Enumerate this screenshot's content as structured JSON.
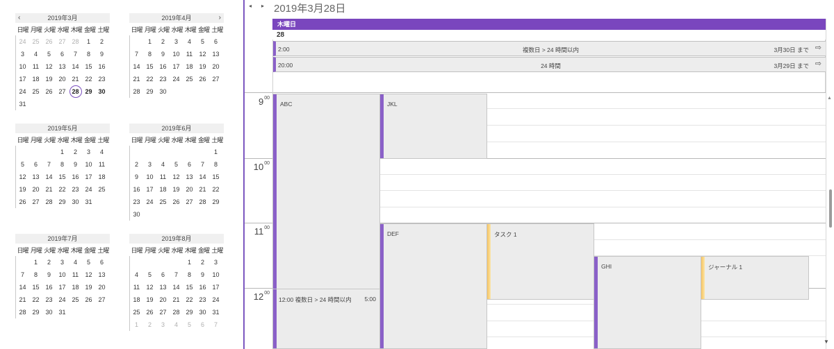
{
  "mini_calendars": {
    "weekdays": [
      "日曜",
      "月曜",
      "火曜",
      "水曜",
      "木曜",
      "金曜",
      "土曜"
    ],
    "nav": {
      "prev": "‹",
      "next": "›"
    },
    "months": [
      {
        "title": "2019年3月",
        "days": [
          {
            "d": "24",
            "o": true
          },
          {
            "d": "25",
            "o": true
          },
          {
            "d": "26",
            "o": true
          },
          {
            "d": "27",
            "o": true
          },
          {
            "d": "28",
            "o": true
          },
          {
            "d": "1"
          },
          {
            "d": "2"
          },
          {
            "d": "3"
          },
          {
            "d": "4"
          },
          {
            "d": "5"
          },
          {
            "d": "6"
          },
          {
            "d": "7"
          },
          {
            "d": "8"
          },
          {
            "d": "9"
          },
          {
            "d": "10"
          },
          {
            "d": "11"
          },
          {
            "d": "12"
          },
          {
            "d": "13"
          },
          {
            "d": "14"
          },
          {
            "d": "15"
          },
          {
            "d": "16"
          },
          {
            "d": "17"
          },
          {
            "d": "18"
          },
          {
            "d": "19"
          },
          {
            "d": "20"
          },
          {
            "d": "21"
          },
          {
            "d": "22"
          },
          {
            "d": "23"
          },
          {
            "d": "24"
          },
          {
            "d": "25"
          },
          {
            "d": "26"
          },
          {
            "d": "27"
          },
          {
            "d": "28",
            "today": true
          },
          {
            "d": "29",
            "b": true
          },
          {
            "d": "30",
            "b": true
          },
          {
            "d": "31"
          }
        ]
      },
      {
        "title": "2019年4月",
        "days": [
          {
            "d": ""
          },
          {
            "d": "1"
          },
          {
            "d": "2"
          },
          {
            "d": "3"
          },
          {
            "d": "4"
          },
          {
            "d": "5"
          },
          {
            "d": "6"
          },
          {
            "d": "7"
          },
          {
            "d": "8"
          },
          {
            "d": "9"
          },
          {
            "d": "10"
          },
          {
            "d": "11"
          },
          {
            "d": "12"
          },
          {
            "d": "13"
          },
          {
            "d": "14"
          },
          {
            "d": "15"
          },
          {
            "d": "16"
          },
          {
            "d": "17"
          },
          {
            "d": "18"
          },
          {
            "d": "19"
          },
          {
            "d": "20"
          },
          {
            "d": "21"
          },
          {
            "d": "22"
          },
          {
            "d": "23"
          },
          {
            "d": "24"
          },
          {
            "d": "25"
          },
          {
            "d": "26"
          },
          {
            "d": "27"
          },
          {
            "d": "28"
          },
          {
            "d": "29"
          },
          {
            "d": "30"
          }
        ]
      },
      {
        "title": "2019年5月",
        "days": [
          {
            "d": ""
          },
          {
            "d": ""
          },
          {
            "d": ""
          },
          {
            "d": "1"
          },
          {
            "d": "2"
          },
          {
            "d": "3"
          },
          {
            "d": "4"
          },
          {
            "d": "5"
          },
          {
            "d": "6"
          },
          {
            "d": "7"
          },
          {
            "d": "8"
          },
          {
            "d": "9"
          },
          {
            "d": "10"
          },
          {
            "d": "11"
          },
          {
            "d": "12"
          },
          {
            "d": "13"
          },
          {
            "d": "14"
          },
          {
            "d": "15"
          },
          {
            "d": "16"
          },
          {
            "d": "17"
          },
          {
            "d": "18"
          },
          {
            "d": "19"
          },
          {
            "d": "20"
          },
          {
            "d": "21"
          },
          {
            "d": "22"
          },
          {
            "d": "23"
          },
          {
            "d": "24"
          },
          {
            "d": "25"
          },
          {
            "d": "26"
          },
          {
            "d": "27"
          },
          {
            "d": "28"
          },
          {
            "d": "29"
          },
          {
            "d": "30"
          },
          {
            "d": "31"
          }
        ]
      },
      {
        "title": "2019年6月",
        "days": [
          {
            "d": ""
          },
          {
            "d": ""
          },
          {
            "d": ""
          },
          {
            "d": ""
          },
          {
            "d": ""
          },
          {
            "d": ""
          },
          {
            "d": "1"
          },
          {
            "d": "2"
          },
          {
            "d": "3"
          },
          {
            "d": "4"
          },
          {
            "d": "5"
          },
          {
            "d": "6"
          },
          {
            "d": "7"
          },
          {
            "d": "8"
          },
          {
            "d": "9"
          },
          {
            "d": "10"
          },
          {
            "d": "11"
          },
          {
            "d": "12"
          },
          {
            "d": "13"
          },
          {
            "d": "14"
          },
          {
            "d": "15"
          },
          {
            "d": "16"
          },
          {
            "d": "17"
          },
          {
            "d": "18"
          },
          {
            "d": "19"
          },
          {
            "d": "20"
          },
          {
            "d": "21"
          },
          {
            "d": "22"
          },
          {
            "d": "23"
          },
          {
            "d": "24"
          },
          {
            "d": "25"
          },
          {
            "d": "26"
          },
          {
            "d": "27"
          },
          {
            "d": "28"
          },
          {
            "d": "29"
          },
          {
            "d": "30"
          }
        ]
      },
      {
        "title": "2019年7月",
        "days": [
          {
            "d": ""
          },
          {
            "d": "1"
          },
          {
            "d": "2"
          },
          {
            "d": "3"
          },
          {
            "d": "4"
          },
          {
            "d": "5"
          },
          {
            "d": "6"
          },
          {
            "d": "7"
          },
          {
            "d": "8"
          },
          {
            "d": "9"
          },
          {
            "d": "10"
          },
          {
            "d": "11"
          },
          {
            "d": "12"
          },
          {
            "d": "13"
          },
          {
            "d": "14"
          },
          {
            "d": "15"
          },
          {
            "d": "16"
          },
          {
            "d": "17"
          },
          {
            "d": "18"
          },
          {
            "d": "19"
          },
          {
            "d": "20"
          },
          {
            "d": "21"
          },
          {
            "d": "22"
          },
          {
            "d": "23"
          },
          {
            "d": "24"
          },
          {
            "d": "25"
          },
          {
            "d": "26"
          },
          {
            "d": "27"
          },
          {
            "d": "28"
          },
          {
            "d": "29"
          },
          {
            "d": "30"
          },
          {
            "d": "31"
          }
        ]
      },
      {
        "title": "2019年8月",
        "days": [
          {
            "d": ""
          },
          {
            "d": ""
          },
          {
            "d": ""
          },
          {
            "d": ""
          },
          {
            "d": "1"
          },
          {
            "d": "2"
          },
          {
            "d": "3"
          },
          {
            "d": "4"
          },
          {
            "d": "5"
          },
          {
            "d": "6"
          },
          {
            "d": "7"
          },
          {
            "d": "8"
          },
          {
            "d": "9"
          },
          {
            "d": "10"
          },
          {
            "d": "11"
          },
          {
            "d": "12"
          },
          {
            "d": "13"
          },
          {
            "d": "14"
          },
          {
            "d": "15"
          },
          {
            "d": "16"
          },
          {
            "d": "17"
          },
          {
            "d": "18"
          },
          {
            "d": "19"
          },
          {
            "d": "20"
          },
          {
            "d": "21"
          },
          {
            "d": "22"
          },
          {
            "d": "23"
          },
          {
            "d": "24"
          },
          {
            "d": "25"
          },
          {
            "d": "26"
          },
          {
            "d": "27"
          },
          {
            "d": "28"
          },
          {
            "d": "29"
          },
          {
            "d": "30"
          },
          {
            "d": "31"
          },
          {
            "d": "1",
            "o": true
          },
          {
            "d": "2",
            "o": true
          },
          {
            "d": "3",
            "o": true
          },
          {
            "d": "4",
            "o": true
          },
          {
            "d": "5",
            "o": true
          },
          {
            "d": "6",
            "o": true
          },
          {
            "d": "7",
            "o": true
          }
        ]
      }
    ]
  },
  "day_view": {
    "nav": {
      "prev": "◂",
      "next": "▸"
    },
    "title": "2019年3月28日",
    "weekday": "木曜日",
    "day_number": "28",
    "all_day_events": [
      {
        "time": "2:00",
        "subject": "複数日 > 24 時間以内",
        "until": "3月30日 まで",
        "arrow": "⇨"
      },
      {
        "time": "20:00",
        "subject": "24 時間",
        "until": "3月29日 まで",
        "arrow": "⇨"
      }
    ],
    "hours": [
      {
        "h": "9",
        "m": "00"
      },
      {
        "h": "10",
        "m": "00"
      },
      {
        "h": "11",
        "m": "00"
      },
      {
        "h": "12",
        "m": "00"
      }
    ],
    "events": [
      {
        "name": "ABC",
        "color": "purple"
      },
      {
        "name": "JKL",
        "color": "purple"
      },
      {
        "name": "DEF",
        "color": "purple"
      },
      {
        "name": "タスク 1",
        "color": "yellow"
      },
      {
        "name": "GHI",
        "color": "purple"
      },
      {
        "name": "ジャーナル 1",
        "color": "yellow"
      },
      {
        "name": "12:00  複数日 > 24 時間以内",
        "end": "5:00",
        "color": "purple"
      }
    ],
    "scroll": {
      "up": "▲",
      "down": "▼"
    }
  },
  "colors": {
    "accent": "#7a46be",
    "event_bg": "#ececec",
    "task_yellow": "#f7c45f"
  }
}
